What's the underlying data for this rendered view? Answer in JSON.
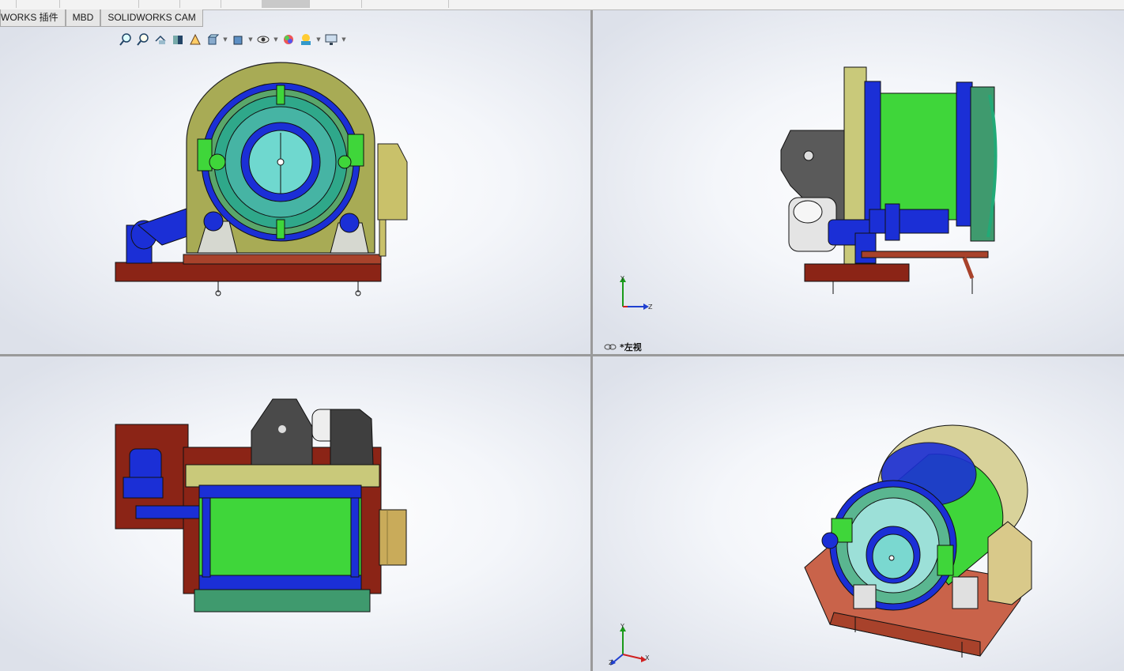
{
  "tabs": [
    {
      "label": "WORKS 插件"
    },
    {
      "label": "MBD"
    },
    {
      "label": "SOLIDWORKS CAM"
    }
  ],
  "hud_icons": [
    "zoom-to-fit-icon",
    "zoom-area-icon",
    "previous-view-icon",
    "section-view-icon",
    "dynamic-annotation-icon",
    "view-orientation-icon",
    "display-style-icon",
    "hide-show-items-icon",
    "edit-appearance-icon",
    "apply-scene-icon",
    "view-settings-icon"
  ],
  "viewports": {
    "top_right": {
      "view_name": "*左视"
    }
  },
  "triad": {
    "x": "X",
    "y": "Y",
    "z": "Z"
  },
  "colors": {
    "frame_red": "#8b2416",
    "base_plate": "#a8422b",
    "drum_green": "#3fd63a",
    "flange_blue": "#1b2fd6",
    "cover_teal": "#46b4a4",
    "housing_olive": "#a8ab55",
    "bracket_gray": "#4a4a4a",
    "panel_khaki": "#c9c16a"
  }
}
